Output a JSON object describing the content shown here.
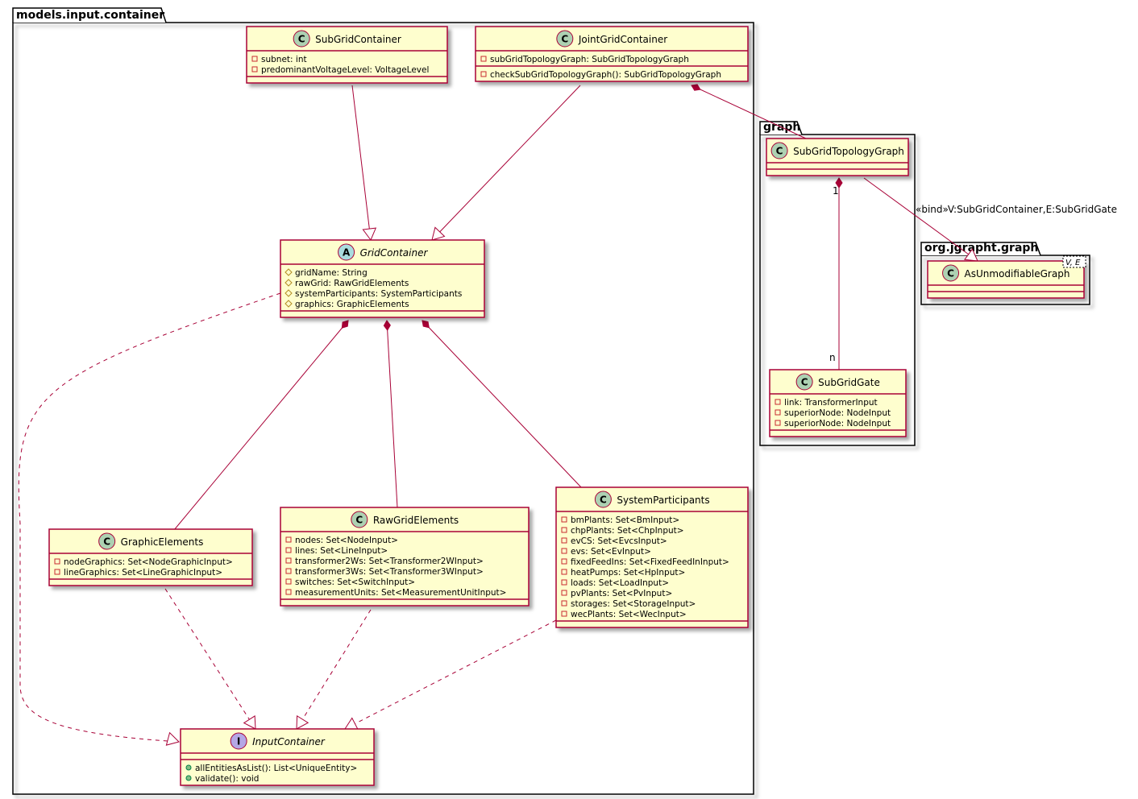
{
  "packages": [
    {
      "id": "models-input-container",
      "name": "models.input.container"
    },
    {
      "id": "graph",
      "name": "graph"
    },
    {
      "id": "org-jgrapht-graph",
      "name": "org.jgrapht.graph"
    }
  ],
  "classes": {
    "SubGridContainer": {
      "kind": "class",
      "name": "SubGridContainer",
      "fields": [
        {
          "vis": "private",
          "text": "subnet: int"
        },
        {
          "vis": "private",
          "text": "predominantVoltageLevel: VoltageLevel"
        }
      ],
      "methods": []
    },
    "JointGridContainer": {
      "kind": "class",
      "name": "JointGridContainer",
      "fields": [
        {
          "vis": "private",
          "text": "subGridTopologyGraph: SubGridTopologyGraph"
        }
      ],
      "methods": [
        {
          "vis": "private",
          "text": "checkSubGridTopologyGraph(): SubGridTopologyGraph"
        }
      ]
    },
    "GridContainer": {
      "kind": "abstract",
      "name": "GridContainer",
      "fields": [
        {
          "vis": "protected",
          "text": "gridName: String"
        },
        {
          "vis": "protected",
          "text": "rawGrid: RawGridElements"
        },
        {
          "vis": "protected",
          "text": "systemParticipants: SystemParticipants"
        },
        {
          "vis": "protected",
          "text": "graphics: GraphicElements"
        }
      ],
      "methods": []
    },
    "GraphicElements": {
      "kind": "class",
      "name": "GraphicElements",
      "fields": [
        {
          "vis": "private",
          "text": "nodeGraphics: Set<NodeGraphicInput>"
        },
        {
          "vis": "private",
          "text": "lineGraphics: Set<LineGraphicInput>"
        }
      ],
      "methods": []
    },
    "RawGridElements": {
      "kind": "class",
      "name": "RawGridElements",
      "fields": [
        {
          "vis": "private",
          "text": "nodes: Set<NodeInput>"
        },
        {
          "vis": "private",
          "text": "lines: Set<LineInput>"
        },
        {
          "vis": "private",
          "text": "transformer2Ws: Set<Transformer2WInput>"
        },
        {
          "vis": "private",
          "text": "transformer3Ws: Set<Transformer3WInput>"
        },
        {
          "vis": "private",
          "text": "switches: Set<SwitchInput>"
        },
        {
          "vis": "private",
          "text": "measurementUnits: Set<MeasurementUnitInput>"
        }
      ],
      "methods": []
    },
    "SystemParticipants": {
      "kind": "class",
      "name": "SystemParticipants",
      "fields": [
        {
          "vis": "private",
          "text": "bmPlants: Set<BmInput>"
        },
        {
          "vis": "private",
          "text": "chpPlants: Set<ChpInput>"
        },
        {
          "vis": "private",
          "text": "evCS: Set<EvcsInput>"
        },
        {
          "vis": "private",
          "text": "evs: Set<EvInput>"
        },
        {
          "vis": "private",
          "text": "fixedFeedIns: Set<FixedFeedInInput>"
        },
        {
          "vis": "private",
          "text": "heatPumps: Set<HpInput>"
        },
        {
          "vis": "private",
          "text": "loads: Set<LoadInput>"
        },
        {
          "vis": "private",
          "text": "pvPlants: Set<PvInput>"
        },
        {
          "vis": "private",
          "text": "storages: Set<StorageInput>"
        },
        {
          "vis": "private",
          "text": "wecPlants: Set<WecInput>"
        }
      ],
      "methods": []
    },
    "InputContainer": {
      "kind": "interface",
      "name": "InputContainer",
      "fields": [],
      "methods": [
        {
          "vis": "public",
          "text": "allEntitiesAsList(): List<UniqueEntity>"
        },
        {
          "vis": "public",
          "text": "validate(): void"
        }
      ]
    },
    "SubGridTopologyGraph": {
      "kind": "class",
      "name": "SubGridTopologyGraph",
      "fields": [],
      "methods": []
    },
    "SubGridGate": {
      "kind": "class",
      "name": "SubGridGate",
      "fields": [
        {
          "vis": "private",
          "text": "link: TransformerInput"
        },
        {
          "vis": "private",
          "text": "superiorNode: NodeInput"
        },
        {
          "vis": "private",
          "text": "superiorNode: NodeInput"
        }
      ],
      "methods": []
    },
    "AsUnmodifiableGraph": {
      "kind": "class",
      "name": "AsUnmodifiableGraph",
      "type_params": "V, E",
      "fields": [],
      "methods": []
    }
  },
  "relations": {
    "bind_label": "«bind»V:SubGridContainer,E:SubGridGate",
    "mult_one": "1",
    "mult_many": "n"
  },
  "colors": {
    "class_fill": "#FEFECE",
    "class_border": "#A80036",
    "class_circle": "#ADD1B2",
    "abstract_circle": "#A9DCDF",
    "interface_circle": "#B4A7E5",
    "edge": "#A80036",
    "package_border": "#000000"
  }
}
